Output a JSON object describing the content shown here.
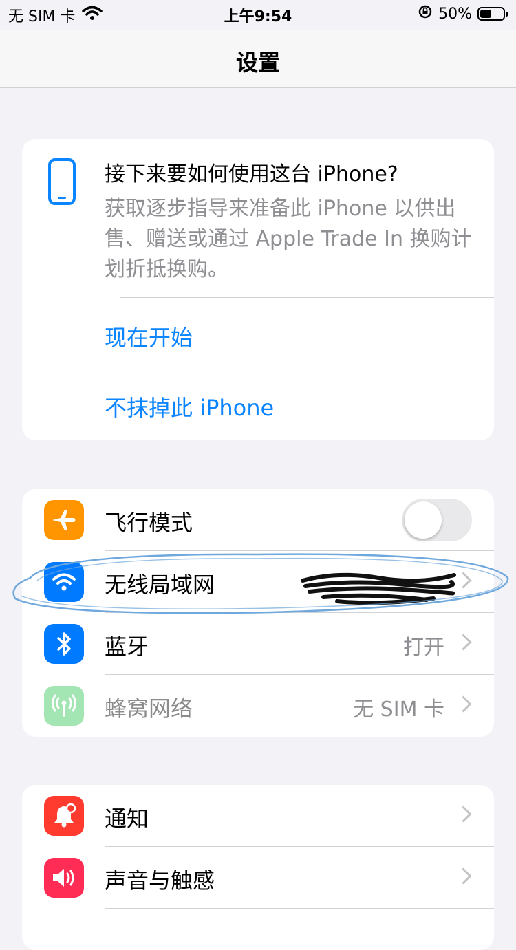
{
  "status_bar": {
    "carrier": "无 SIM 卡",
    "time": "上午9:54",
    "battery_percent_text": "50%",
    "battery_level": 0.5
  },
  "nav": {
    "title": "设置"
  },
  "promo": {
    "title": "接下来要如何使用这台 iPhone?",
    "description": "获取逐步指导来准备此 iPhone 以供出售、赠送或通过 Apple Trade In 换购计划折抵换购。",
    "link_start": "现在开始",
    "link_keep": "不抹掉此 iPhone"
  },
  "connectivity": {
    "airplane": {
      "label": "飞行模式",
      "toggle_on": false,
      "icon": "airplane-icon",
      "color": "#ff9500"
    },
    "wifi": {
      "label": "无线局域网",
      "value": "",
      "icon": "wifi-icon",
      "color": "#007aff"
    },
    "bluetooth": {
      "label": "蓝牙",
      "value": "打开",
      "icon": "bluetooth-icon",
      "color": "#007aff"
    },
    "cellular": {
      "label": "蜂窝网络",
      "value": "无 SIM 卡",
      "icon": "antenna-icon",
      "color": "#34c759"
    }
  },
  "general": {
    "notifications": {
      "label": "通知",
      "icon": "bell-icon",
      "color": "#ff3b30"
    },
    "sounds": {
      "label": "声音与触感",
      "icon": "speaker-icon",
      "color": "#ff2d55"
    }
  },
  "colors": {
    "accent": "#0a84ff",
    "background": "#f2f2f7",
    "annotation": "#6fa8dc"
  }
}
